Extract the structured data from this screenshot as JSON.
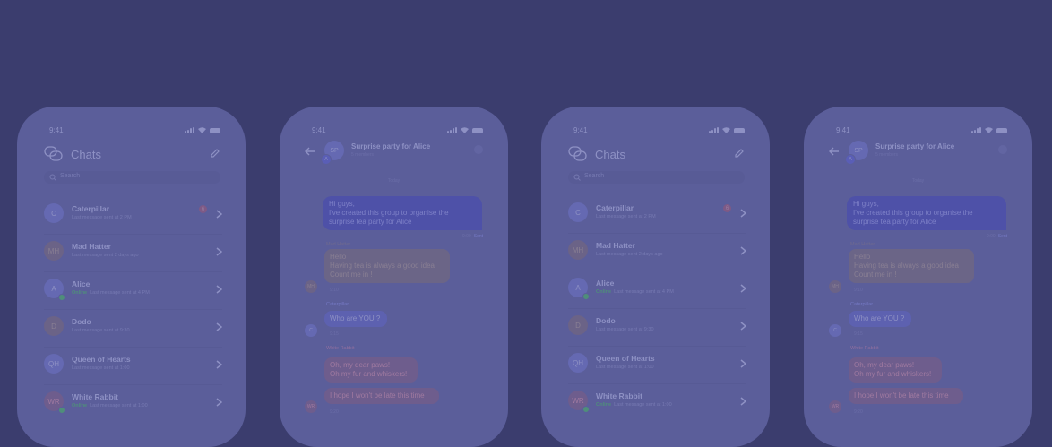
{
  "status": {
    "time": "9:41"
  },
  "chat_list": {
    "title": "Chats",
    "search_placeholder": "Search",
    "items": [
      {
        "name": "Caterpillar",
        "initials": "C",
        "subtitle": "Last message sent at 2 PM",
        "online": false,
        "badge": "6"
      },
      {
        "name": "Mad Hatter",
        "initials": "MH",
        "subtitle": "Last message sent 2 days ago",
        "online": false
      },
      {
        "name": "Alice",
        "initials": "A",
        "status": "Online",
        "subtitle": "Last message sent at 4 PM",
        "online": true
      },
      {
        "name": "Dodo",
        "initials": "D",
        "subtitle": "Last message sent at 9:30",
        "online": false
      },
      {
        "name": "Queen of Hearts",
        "initials": "QH",
        "subtitle": "Last message sent at 1:00",
        "online": false
      },
      {
        "name": "White Rabbit",
        "initials": "WR",
        "status": "Online",
        "subtitle": "Last message sent at 1:00",
        "online": true
      }
    ]
  },
  "conversation": {
    "title": "Surprise party for Alice",
    "subtitle": "5 members",
    "avatar_initials": "SP",
    "avatar_sub_initials": "A",
    "date_divider": "Today",
    "outgoing": {
      "lines": [
        "Hi guys,",
        "I've created this group to organise the",
        "surprise tea party for Alice"
      ],
      "time": "9:00",
      "status": "Sent"
    },
    "messages": [
      {
        "sender": "Mad Hatter",
        "initials": "MH",
        "lines": [
          "Hello",
          "Having tea is always a good idea",
          "Count me in !"
        ],
        "time": "9:10"
      },
      {
        "sender": "Caterpillar",
        "initials": "C",
        "lines": [
          "Who are YOU ?"
        ],
        "time": "9:15"
      },
      {
        "sender": "White Rabbit",
        "initials": "WR",
        "lines": [
          "Oh, my dear paws!",
          "Oh my fur and whiskers!"
        ],
        "time": ""
      },
      {
        "sender": "",
        "initials": "WR",
        "lines": [
          "I hope I won't be late this time"
        ],
        "time": "9:20"
      }
    ]
  },
  "colors": {
    "overlay": "#3b3d6e",
    "accent": "#5a5eb6",
    "online": "#4f8e7a"
  }
}
